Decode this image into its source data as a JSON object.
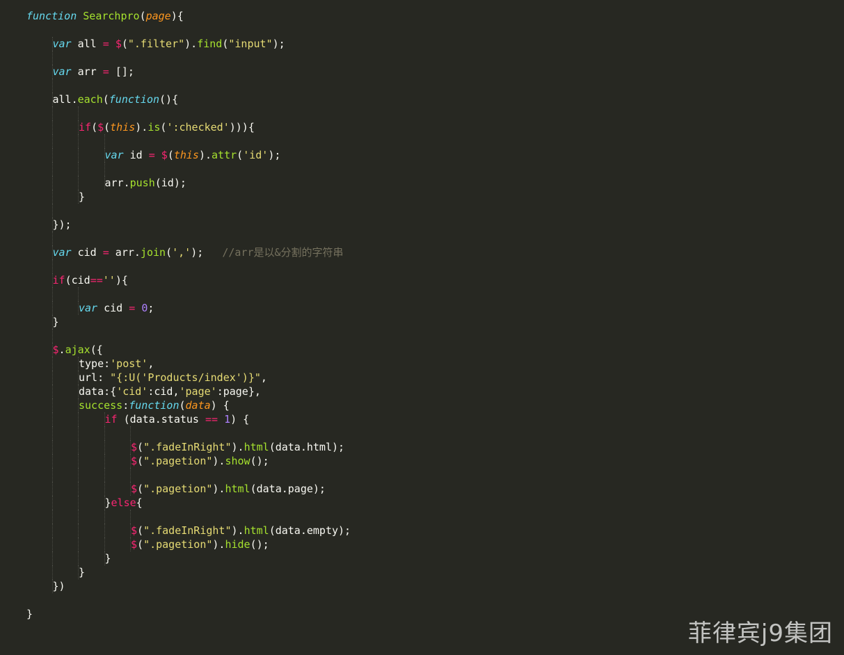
{
  "editor": {
    "theme_colors": {
      "background": "#272822",
      "plain": "#f8f8f2",
      "keyword": "#66d9ef",
      "function": "#a6e22e",
      "param": "#fd971f",
      "string": "#e6db74",
      "operator": "#f92672",
      "number": "#ae81ff",
      "comment": "#75715e"
    },
    "lines": [
      {
        "indent": 0,
        "tokens": [
          [
            "kw",
            "function"
          ],
          [
            "pl",
            " "
          ],
          [
            "fn",
            "Searchpro"
          ],
          [
            "pl",
            "("
          ],
          [
            "prm",
            "page"
          ],
          [
            "pl",
            "){"
          ]
        ]
      },
      {
        "indent": 0,
        "tokens": []
      },
      {
        "indent": 1,
        "tokens": [
          [
            "kw",
            "var"
          ],
          [
            "pl",
            " all "
          ],
          [
            "op",
            "="
          ],
          [
            "pl",
            " "
          ],
          [
            "op",
            "$"
          ],
          [
            "pl",
            "("
          ],
          [
            "str",
            "\".filter\""
          ],
          [
            "pl",
            ")."
          ],
          [
            "fn",
            "find"
          ],
          [
            "pl",
            "("
          ],
          [
            "str",
            "\"input\""
          ],
          [
            "pl",
            ");"
          ]
        ]
      },
      {
        "indent": 1,
        "tokens": []
      },
      {
        "indent": 1,
        "tokens": [
          [
            "kw",
            "var"
          ],
          [
            "pl",
            " arr "
          ],
          [
            "op",
            "="
          ],
          [
            "pl",
            " [];"
          ]
        ]
      },
      {
        "indent": 1,
        "tokens": []
      },
      {
        "indent": 1,
        "tokens": [
          [
            "pl",
            "all."
          ],
          [
            "fn",
            "each"
          ],
          [
            "pl",
            "("
          ],
          [
            "kw",
            "function"
          ],
          [
            "pl",
            "(){"
          ]
        ]
      },
      {
        "indent": 2,
        "tokens": []
      },
      {
        "indent": 2,
        "tokens": [
          [
            "op",
            "if"
          ],
          [
            "pl",
            "("
          ],
          [
            "op",
            "$"
          ],
          [
            "pl",
            "("
          ],
          [
            "prm",
            "this"
          ],
          [
            "pl",
            ")."
          ],
          [
            "fn",
            "is"
          ],
          [
            "pl",
            "("
          ],
          [
            "str",
            "':checked'"
          ],
          [
            "pl",
            "))){"
          ]
        ]
      },
      {
        "indent": 3,
        "tokens": []
      },
      {
        "indent": 3,
        "tokens": [
          [
            "kw",
            "var"
          ],
          [
            "pl",
            " id "
          ],
          [
            "op",
            "="
          ],
          [
            "pl",
            " "
          ],
          [
            "op",
            "$"
          ],
          [
            "pl",
            "("
          ],
          [
            "prm",
            "this"
          ],
          [
            "pl",
            ")."
          ],
          [
            "fn",
            "attr"
          ],
          [
            "pl",
            "("
          ],
          [
            "str",
            "'id'"
          ],
          [
            "pl",
            ");"
          ]
        ]
      },
      {
        "indent": 3,
        "tokens": []
      },
      {
        "indent": 3,
        "tokens": [
          [
            "pl",
            "arr."
          ],
          [
            "fn",
            "push"
          ],
          [
            "pl",
            "(id);"
          ]
        ]
      },
      {
        "indent": 2,
        "tokens": [
          [
            "pl",
            "}"
          ]
        ]
      },
      {
        "indent": 1,
        "tokens": []
      },
      {
        "indent": 1,
        "tokens": [
          [
            "pl",
            "});"
          ]
        ]
      },
      {
        "indent": 1,
        "tokens": []
      },
      {
        "indent": 1,
        "tokens": [
          [
            "kw",
            "var"
          ],
          [
            "pl",
            " cid "
          ],
          [
            "op",
            "="
          ],
          [
            "pl",
            " arr."
          ],
          [
            "fn",
            "join"
          ],
          [
            "pl",
            "("
          ],
          [
            "str",
            "','"
          ],
          [
            "pl",
            ");   "
          ],
          [
            "cm",
            "//arr是以&分割的字符串"
          ]
        ]
      },
      {
        "indent": 1,
        "tokens": []
      },
      {
        "indent": 1,
        "tokens": [
          [
            "op",
            "if"
          ],
          [
            "pl",
            "(cid"
          ],
          [
            "op",
            "=="
          ],
          [
            "str",
            "''"
          ],
          [
            "pl",
            "){"
          ]
        ]
      },
      {
        "indent": 2,
        "tokens": []
      },
      {
        "indent": 2,
        "tokens": [
          [
            "kw",
            "var"
          ],
          [
            "pl",
            " cid "
          ],
          [
            "op",
            "="
          ],
          [
            "pl",
            " "
          ],
          [
            "num",
            "0"
          ],
          [
            "pl",
            ";"
          ]
        ]
      },
      {
        "indent": 1,
        "tokens": [
          [
            "pl",
            "}"
          ]
        ]
      },
      {
        "indent": 1,
        "tokens": []
      },
      {
        "indent": 1,
        "tokens": [
          [
            "op",
            "$"
          ],
          [
            "pl",
            "."
          ],
          [
            "fn",
            "ajax"
          ],
          [
            "pl",
            "({"
          ]
        ]
      },
      {
        "indent": 2,
        "tokens": [
          [
            "pl",
            "type:"
          ],
          [
            "str",
            "'post'"
          ],
          [
            "pl",
            ","
          ]
        ]
      },
      {
        "indent": 2,
        "tokens": [
          [
            "pl",
            "url: "
          ],
          [
            "str",
            "\"{:U('Products/index')}\""
          ],
          [
            "pl",
            ","
          ]
        ]
      },
      {
        "indent": 2,
        "tokens": [
          [
            "pl",
            "data:{"
          ],
          [
            "str",
            "'cid'"
          ],
          [
            "pl",
            ":cid,"
          ],
          [
            "str",
            "'page'"
          ],
          [
            "pl",
            ":page},"
          ]
        ]
      },
      {
        "indent": 2,
        "tokens": [
          [
            "fn",
            "success"
          ],
          [
            "pl",
            ":"
          ],
          [
            "kw",
            "function"
          ],
          [
            "pl",
            "("
          ],
          [
            "prm",
            "data"
          ],
          [
            "pl",
            ") {"
          ]
        ]
      },
      {
        "indent": 3,
        "tokens": [
          [
            "op",
            "if"
          ],
          [
            "pl",
            " (data.status "
          ],
          [
            "op",
            "=="
          ],
          [
            "pl",
            " "
          ],
          [
            "num",
            "1"
          ],
          [
            "pl",
            ") {"
          ]
        ]
      },
      {
        "indent": 4,
        "tokens": []
      },
      {
        "indent": 4,
        "tokens": [
          [
            "op",
            "$"
          ],
          [
            "pl",
            "("
          ],
          [
            "str",
            "\".fadeInRight\""
          ],
          [
            "pl",
            ")."
          ],
          [
            "fn",
            "html"
          ],
          [
            "pl",
            "(data.html);"
          ]
        ]
      },
      {
        "indent": 4,
        "tokens": [
          [
            "op",
            "$"
          ],
          [
            "pl",
            "("
          ],
          [
            "str",
            "\".pagetion\""
          ],
          [
            "pl",
            ")."
          ],
          [
            "fn",
            "show"
          ],
          [
            "pl",
            "();"
          ]
        ]
      },
      {
        "indent": 4,
        "tokens": []
      },
      {
        "indent": 4,
        "tokens": [
          [
            "op",
            "$"
          ],
          [
            "pl",
            "("
          ],
          [
            "str",
            "\".pagetion\""
          ],
          [
            "pl",
            ")."
          ],
          [
            "fn",
            "html"
          ],
          [
            "pl",
            "(data.page);"
          ]
        ]
      },
      {
        "indent": 3,
        "tokens": [
          [
            "pl",
            "}"
          ],
          [
            "op",
            "else"
          ],
          [
            "pl",
            "{"
          ]
        ]
      },
      {
        "indent": 4,
        "tokens": []
      },
      {
        "indent": 4,
        "tokens": [
          [
            "op",
            "$"
          ],
          [
            "pl",
            "("
          ],
          [
            "str",
            "\".fadeInRight\""
          ],
          [
            "pl",
            ")."
          ],
          [
            "fn",
            "html"
          ],
          [
            "pl",
            "(data.empty);"
          ]
        ]
      },
      {
        "indent": 4,
        "tokens": [
          [
            "op",
            "$"
          ],
          [
            "pl",
            "("
          ],
          [
            "str",
            "\".pagetion\""
          ],
          [
            "pl",
            ")."
          ],
          [
            "fn",
            "hide"
          ],
          [
            "pl",
            "();"
          ]
        ]
      },
      {
        "indent": 3,
        "tokens": [
          [
            "pl",
            "}"
          ]
        ]
      },
      {
        "indent": 2,
        "tokens": [
          [
            "pl",
            "}"
          ]
        ]
      },
      {
        "indent": 1,
        "tokens": [
          [
            "pl",
            "})"
          ]
        ]
      },
      {
        "indent": 0,
        "tokens": []
      },
      {
        "indent": 0,
        "tokens": [
          [
            "pl",
            "}"
          ]
        ]
      }
    ]
  },
  "watermark": {
    "text": "菲律宾j9集团"
  }
}
